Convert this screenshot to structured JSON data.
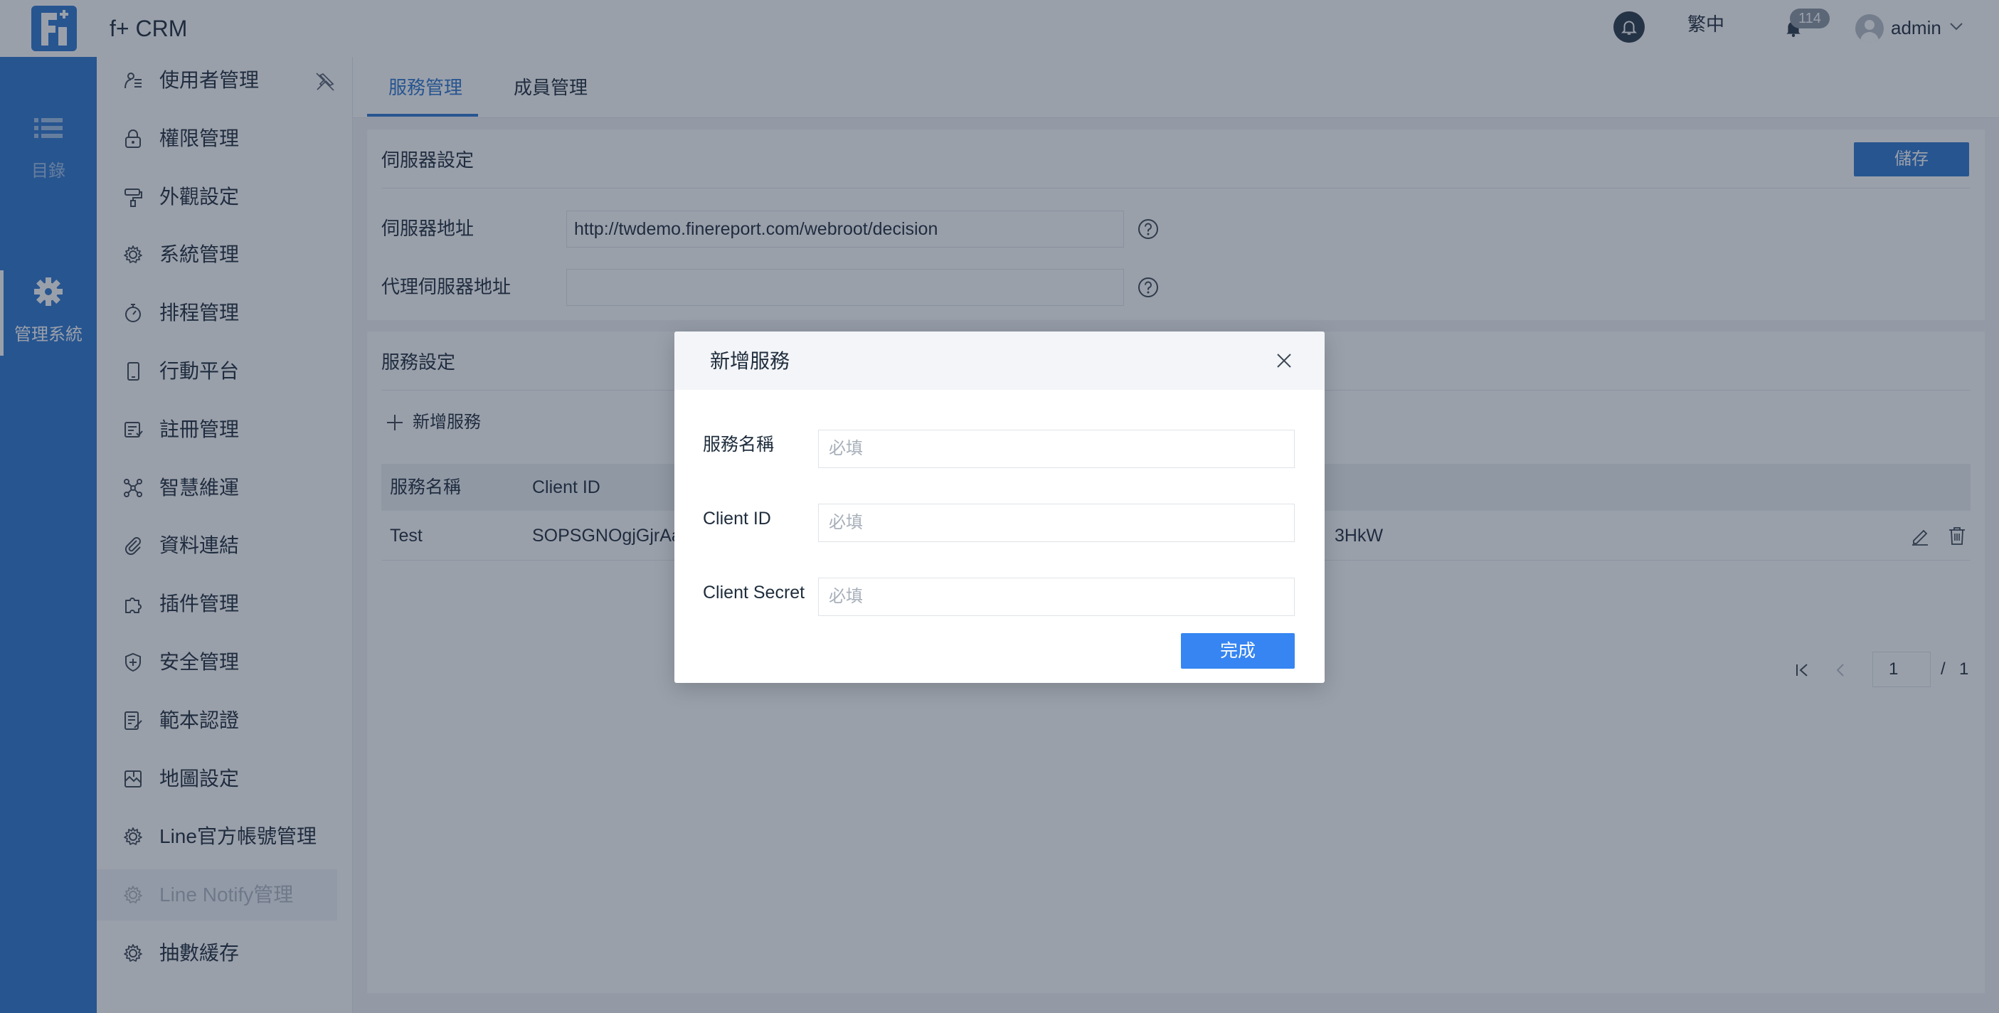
{
  "header": {
    "app_title": "f+ CRM",
    "language": "繁中",
    "notification_count": "114",
    "username": "admin"
  },
  "rail": {
    "items": [
      {
        "label": "目錄",
        "icon": "list-icon"
      },
      {
        "label": "管理系統",
        "icon": "gear-icon"
      }
    ]
  },
  "sidebar": {
    "items": [
      {
        "label": "使用者管理",
        "icon": "user-manage-icon"
      },
      {
        "label": "權限管理",
        "icon": "lock-icon"
      },
      {
        "label": "外觀設定",
        "icon": "paint-roller-icon"
      },
      {
        "label": "系統管理",
        "icon": "gear-icon"
      },
      {
        "label": "排程管理",
        "icon": "stopwatch-icon"
      },
      {
        "label": "行動平台",
        "icon": "mobile-icon"
      },
      {
        "label": "註冊管理",
        "icon": "register-icon"
      },
      {
        "label": "智慧維運",
        "icon": "network-icon"
      },
      {
        "label": "資料連結",
        "icon": "paperclip-icon"
      },
      {
        "label": "插件管理",
        "icon": "puzzle-icon"
      },
      {
        "label": "安全管理",
        "icon": "shield-icon"
      },
      {
        "label": "範本認證",
        "icon": "template-cert-icon"
      },
      {
        "label": "地圖設定",
        "icon": "map-icon"
      },
      {
        "label": "Line官方帳號管理",
        "icon": "gear-icon"
      },
      {
        "label": "Line Notify管理",
        "icon": "gear-icon"
      },
      {
        "label": "抽數緩存",
        "icon": "gear-icon"
      }
    ],
    "active_index": 14
  },
  "tabs": [
    {
      "label": "服務管理"
    },
    {
      "label": "成員管理"
    }
  ],
  "server_settings": {
    "title": "伺服器設定",
    "save_label": "儲存",
    "server_address_label": "伺服器地址",
    "server_address_value": "http://twdemo.finereport.com/webroot/decision",
    "proxy_address_label": "代理伺服器地址",
    "proxy_address_value": ""
  },
  "service_settings": {
    "title": "服務設定",
    "add_label": "新增服務",
    "columns": [
      "服務名稱",
      "Client ID"
    ],
    "rows": [
      {
        "name": "Test",
        "client_id": "SOPSGNOgjGjrAax",
        "client_secret_tail": "3HkW"
      }
    ]
  },
  "pager": {
    "current": "1",
    "separator": "/",
    "total": "1"
  },
  "modal": {
    "title": "新增服務",
    "fields": [
      {
        "label": "服務名稱",
        "placeholder": "必填"
      },
      {
        "label": "Client ID",
        "placeholder": "必填"
      },
      {
        "label": "Client Secret",
        "placeholder": "必填"
      }
    ],
    "done_label": "完成"
  },
  "colors": {
    "brand": "#2e77d0",
    "primary_button": "#3685f2",
    "overlay": "#1e2c42"
  }
}
